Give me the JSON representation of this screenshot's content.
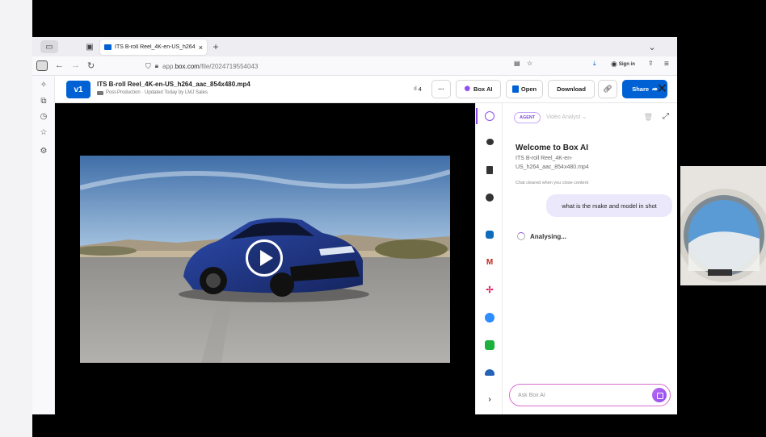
{
  "browser": {
    "tab_title": "ITS B-roll Reel_4K-en-US_h264",
    "tab_close": "×",
    "new_tab": "+",
    "chevron": "⌄",
    "url_prefix": "app.",
    "url_host": "box.com",
    "url_path": "/file/2024719554043",
    "sign_in": "Sign in"
  },
  "file_header": {
    "version_badge": "v1",
    "file_name": "ITS B-roll Reel_4K-en-US_h264_aac_854x480.mp4",
    "file_meta": "Post-Production · Updated Today by LMJ Sales",
    "views_count": "4",
    "more": "···",
    "box_ai_label": "Box AI",
    "open_label": "Open",
    "download_label": "Download",
    "share_label": "Share",
    "close": "✕"
  },
  "ai_panel": {
    "agent_label": "AGENT",
    "agent_name": "Video Analyst",
    "welcome_title": "Welcome to Box AI",
    "welcome_file": "ITS B-roll Reel_4K-en-US_h264_aac_854x480.mp4",
    "chat_note": "Chat cleared when you close content",
    "user_message": "what is the make and model in shot",
    "status": "Analysing...",
    "input_placeholder": "Ask Box AI"
  },
  "colors": {
    "box_blue": "#0061d5",
    "ai_purple": "#8e4cf0",
    "user_bubble": "#ece8fb"
  },
  "icons": {
    "integrations": [
      "box-ai-icon",
      "comments-icon",
      "document-icon",
      "activity-icon",
      "outlook-icon",
      "gmail-icon",
      "slack-icon",
      "zoom-icon",
      "smartsheet-icon",
      "onedrive-icon",
      "chevron-right-icon"
    ]
  }
}
